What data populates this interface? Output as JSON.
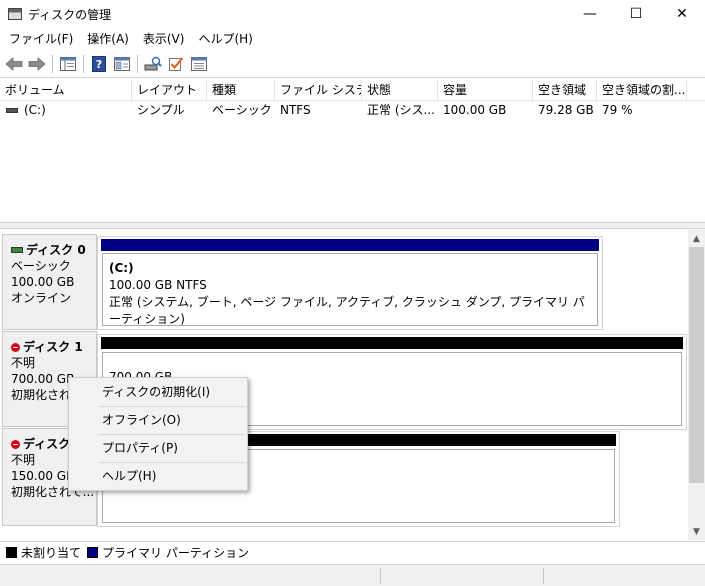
{
  "window": {
    "title": "ディスクの管理",
    "minimize": "—",
    "maximize": "☐",
    "close": "✕"
  },
  "menu": [
    "ファイル(F)",
    "操作(A)",
    "表示(V)",
    "ヘルプ(H)"
  ],
  "toolbar": {
    "icons": [
      "back-arrow-icon",
      "forward-arrow-icon",
      "console-tree-icon",
      "help-icon",
      "properties-icon",
      "rescan-disks-icon",
      "checklist-icon",
      "detail-view-icon"
    ]
  },
  "volume_list": {
    "columns": [
      "ボリューム",
      "レイアウト",
      "種類",
      "ファイル システム",
      "状態",
      "容量",
      "空き領域",
      "空き領域の割..."
    ],
    "rows": [
      {
        "volume": "(C:)",
        "layout": "シンプル",
        "type": "ベーシック",
        "fs": "NTFS",
        "status": "正常 (シス...",
        "capacity": "100.00 GB",
        "free": "79.28 GB",
        "free_pct": "79 %"
      }
    ]
  },
  "disks": [
    {
      "name": "ディスク 0",
      "type": "ベーシック",
      "size": "100.00 GB",
      "state": "オンライン",
      "partition": {
        "label": "(C:)",
        "size_fs": "100.00 GB NTFS",
        "status": "正常 (システム, ブート, ページ ファイル, アクティブ, クラッシュ ダンプ, プライマリ パーティション)"
      }
    },
    {
      "name": "ディスク 1",
      "type": "不明",
      "size": "700.00 GB",
      "state": "初期化されて",
      "partition": {
        "size": "700.00 GB"
      }
    },
    {
      "name": "ディスク 2",
      "type": "不明",
      "size": "150.00 GB",
      "state": "初期化されて...",
      "partition": {
        "status": "未割り当て"
      }
    }
  ],
  "context_menu": [
    "ディスクの初期化(I)",
    "オフライン(O)",
    "プロパティ(P)",
    "ヘルプ(H)"
  ],
  "legend": [
    {
      "label": "未割り当て",
      "color": "#000000"
    },
    {
      "label": "プライマリ パーティション",
      "color": "#000080"
    }
  ],
  "colors": {
    "primary_partition": "#000080",
    "unallocated": "#000000"
  }
}
